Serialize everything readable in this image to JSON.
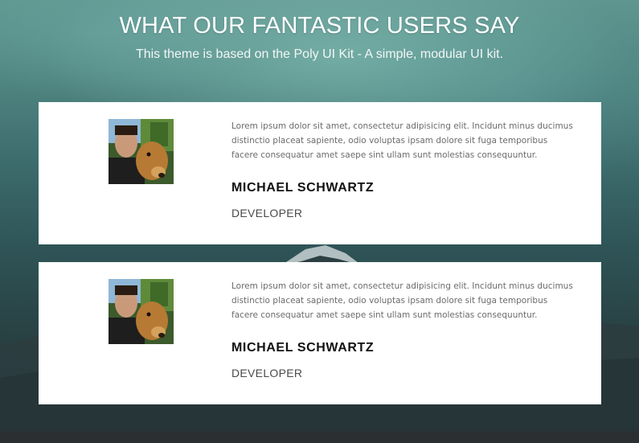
{
  "section": {
    "title": "WHAT OUR FANTASTIC USERS SAY",
    "subtitle": "This theme is based on the Poly UI Kit - A simple, modular UI kit."
  },
  "testimonials": [
    {
      "quote": "Lorem ipsum dolor sit amet, consectetur adipisicing elit. Incidunt minus ducimus distinctio placeat sapiente, odio voluptas ipsam dolore sit fuga temporibus facere consequatur amet saepe sint ullam sunt molestias consequuntur.",
      "name": "MICHAEL SCHWARTZ",
      "role": "DEVELOPER"
    },
    {
      "quote": "Lorem ipsum dolor sit amet, consectetur adipisicing elit. Incidunt minus ducimus distinctio placeat sapiente, odio voluptas ipsam dolore sit fuga temporibus facere consequatur amet saepe sint ullam sunt molestias consequuntur.",
      "name": "MICHAEL SCHWARTZ",
      "role": "DEVELOPER"
    }
  ],
  "colors": {
    "card_background": "#ffffff",
    "heading_text": "#ffffff",
    "name_text": "#111111",
    "quote_text": "#6b6b6b",
    "role_text": "#4a4a4a"
  }
}
